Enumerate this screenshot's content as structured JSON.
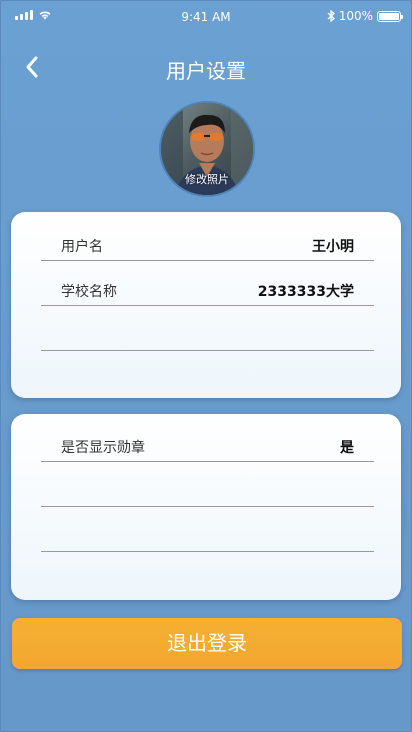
{
  "status_bar": {
    "time": "9:41 AM",
    "battery": "100%",
    "battery_level": 1.0
  },
  "header": {
    "title": "用户设置"
  },
  "avatar": {
    "caption": "修改照片"
  },
  "profile_card": {
    "rows": [
      {
        "label": "用户名",
        "value": "王小明"
      },
      {
        "label": "学校名称",
        "value": "2333333大学"
      },
      {
        "label": "",
        "value": ""
      }
    ]
  },
  "settings_card": {
    "rows": [
      {
        "label": "是否显示勋章",
        "value": "是"
      },
      {
        "label": "",
        "value": ""
      },
      {
        "label": "",
        "value": ""
      }
    ]
  },
  "logout_label": "退出登录",
  "colors": {
    "background": "#6a9ccd",
    "accent": "#f4aa31",
    "card": "#ffffff"
  }
}
